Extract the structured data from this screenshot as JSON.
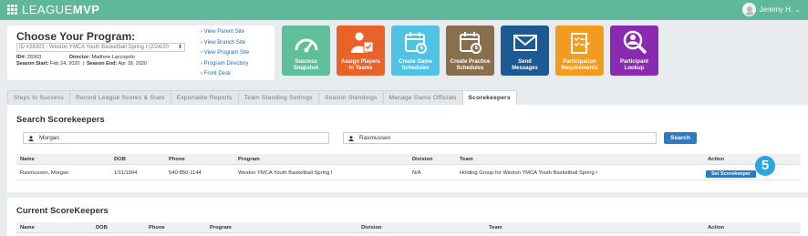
{
  "app": {
    "logo_league": "LEAGUE",
    "logo_mvp": "MVP",
    "user_name": "Jeremy H. ⌄"
  },
  "program": {
    "title": "Choose Your Program:",
    "select_value": "ID #28303 - Weston YMCA Youth Basketball Spring I (2/24/20",
    "id_label": "ID#:",
    "id_value": "28303",
    "director_label": "Director:",
    "director_value": "Matthew Laccopolo",
    "season_start_label": "Season Start:",
    "season_start_value": "Feb 24, 2020",
    "separator": "|",
    "season_end_label": "Season End:",
    "season_end_value": "Apr 18, 2020",
    "links": [
      "View Parent Site",
      "View Branch Site",
      "View Program Site",
      "Program Directory",
      "Front Desk"
    ]
  },
  "tiles": [
    {
      "label_1": "Success",
      "label_2": "Snapshot",
      "color": "#5fbf9b",
      "icon": "gauge-icon"
    },
    {
      "label_1": "Assign Players",
      "label_2": "to Teams",
      "color": "#e8622a",
      "icon": "assign-players-icon"
    },
    {
      "label_1": "Create Game",
      "label_2": "Schedules",
      "color": "#4ec3e6",
      "icon": "calendar-icon"
    },
    {
      "label_1": "Create Practice",
      "label_2": "Schedules",
      "color": "#8a6f4e",
      "icon": "practice-calendar-icon"
    },
    {
      "label_1": "Send",
      "label_2": "Messages",
      "color": "#1d5a93",
      "icon": "envelope-icon"
    },
    {
      "label_1": "Participation",
      "label_2": "Requirements",
      "color": "#f29b1f",
      "icon": "checklist-icon"
    },
    {
      "label_1": "Participant",
      "label_2": "Lookup",
      "color": "#8a2ab0",
      "icon": "magnifier-person-icon"
    }
  ],
  "tabs": [
    {
      "label": "Steps to Success",
      "active": false
    },
    {
      "label": "Record League Scores & Stats",
      "active": false
    },
    {
      "label": "Exportable Reports",
      "active": false
    },
    {
      "label": "Team Standing Settings",
      "active": false
    },
    {
      "label": "Season Standings",
      "active": false
    },
    {
      "label": "Manage Game Officials",
      "active": false
    },
    {
      "label": "Scorekeepers",
      "active": true
    }
  ],
  "search": {
    "title": "Search Scorekeepers",
    "first_name_value": "Morgan",
    "last_name_value": "Rasmussen",
    "button_label": "Search"
  },
  "results_table": {
    "headers": [
      "Name",
      "DOB",
      "Phone",
      "Program",
      "Division",
      "Team",
      "Action"
    ],
    "rows": [
      {
        "name": "Rasmussen, Morgan",
        "dob": "1/11/1994",
        "phone": "540-850-1144",
        "program": "Weston YMCA Youth Basketball Spring I",
        "division": "N/A",
        "team": "Holding Group for Weston YMCA Youth Basketball Spring I",
        "action": "Set Scorekeeper"
      }
    ]
  },
  "step_badge": "5",
  "current": {
    "title": "Current ScoreKeepers",
    "headers": [
      "Name",
      "DOB",
      "Phone",
      "Program",
      "Division",
      "Team",
      "Action"
    ]
  }
}
